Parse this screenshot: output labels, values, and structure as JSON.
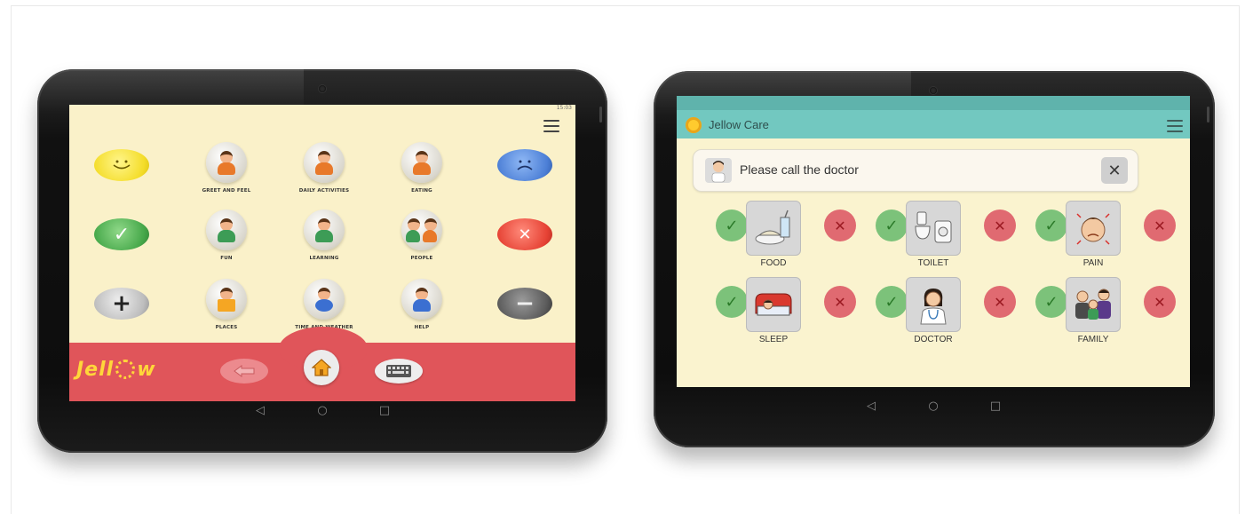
{
  "left_tablet": {
    "status_time": "15:03",
    "categories": [
      {
        "label": "GREET AND FEEL"
      },
      {
        "label": "DAILY ACTIVITIES"
      },
      {
        "label": "EATING"
      },
      {
        "label": "FUN"
      },
      {
        "label": "LEARNING"
      },
      {
        "label": "PEOPLE"
      },
      {
        "label": "PLACES"
      },
      {
        "label": "TIME AND WEATHER"
      },
      {
        "label": "HELP"
      }
    ],
    "left_column": [
      "smiley-like-icon",
      "check-yes-icon",
      "plus-more-icon"
    ],
    "right_column": [
      "sad-dislike-icon",
      "cross-no-icon",
      "minus-less-icon"
    ],
    "logo_text": "Jell",
    "logo_text_end": "w",
    "bottom_buttons": [
      "back-arrow-icon",
      "home-icon",
      "keyboard-icon"
    ],
    "nav_buttons": {
      "back": "◁",
      "home": "○",
      "recent": "□"
    }
  },
  "right_tablet": {
    "app_title": "Jellow Care",
    "speech_text": "Please call the doctor",
    "tiles": [
      {
        "label": "FOOD"
      },
      {
        "label": "TOILET"
      },
      {
        "label": "PAIN"
      },
      {
        "label": "SLEEP"
      },
      {
        "label": "DOCTOR"
      },
      {
        "label": "FAMILY"
      }
    ],
    "nav_buttons": {
      "back": "◁",
      "home": "○",
      "recent": "□"
    }
  },
  "colors": {
    "screen_bg": "#faf1c9",
    "bottom_bar": "#e0555a",
    "header_teal": "#72c8c0",
    "yes_green": "#7cc27a",
    "no_red": "#e06a71"
  }
}
